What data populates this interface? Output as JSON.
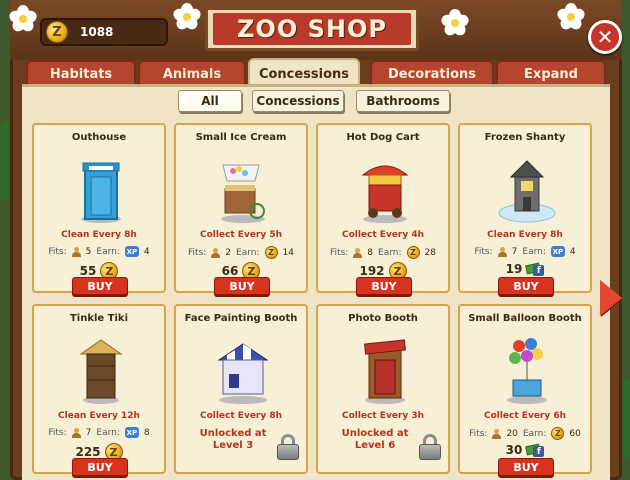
{
  "header": {
    "coins": "1088",
    "coin_symbol": "Z",
    "title": "ZOO SHOP",
    "close_symbol": "✕"
  },
  "tabs": [
    {
      "label": "Habitats",
      "active": false
    },
    {
      "label": "Animals",
      "active": false
    },
    {
      "label": "Concessions",
      "active": true
    },
    {
      "label": "Decorations",
      "active": false
    },
    {
      "label": "Expand",
      "active": false
    }
  ],
  "filters": [
    {
      "label": "All",
      "selected": true
    },
    {
      "label": "Concessions",
      "selected": false
    },
    {
      "label": "Bathrooms",
      "selected": false
    }
  ],
  "labels": {
    "fits": "Fits:",
    "earn": "Earn:",
    "xp": "XP",
    "buy": "BUY",
    "fb": "f"
  },
  "items": [
    {
      "name": "Outhouse",
      "action": "Clean Every 8h",
      "fits": "5",
      "earn": "4",
      "earn_type": "xp",
      "price": "55",
      "currency": "coins"
    },
    {
      "name": "Small Ice Cream",
      "action": "Collect Every 5h",
      "fits": "2",
      "earn": "14",
      "earn_type": "coins",
      "price": "66",
      "currency": "coins"
    },
    {
      "name": "Hot Dog Cart",
      "action": "Collect Every 4h",
      "fits": "8",
      "earn": "28",
      "earn_type": "coins",
      "price": "192",
      "currency": "coins"
    },
    {
      "name": "Frozen Shanty",
      "action": "Clean Every 8h",
      "fits": "7",
      "earn": "4",
      "earn_type": "xp",
      "price": "19",
      "currency": "cash"
    },
    {
      "name": "Tinkle Tiki",
      "action": "Clean Every 12h",
      "fits": "7",
      "earn": "8",
      "earn_type": "xp",
      "price": "225",
      "currency": "coins"
    },
    {
      "name": "Face Painting Booth",
      "action": "Collect Every 8h",
      "locked_line1": "Unlocked at",
      "locked_line2": "Level 3"
    },
    {
      "name": "Photo Booth",
      "action": "Collect Every 3h",
      "locked_line1": "Unlocked at",
      "locked_line2": "Level 6"
    },
    {
      "name": "Small Balloon Booth",
      "action": "Collect Every 6h",
      "fits": "20",
      "earn": "60",
      "earn_type": "coins",
      "price": "30",
      "currency": "cash"
    }
  ]
}
